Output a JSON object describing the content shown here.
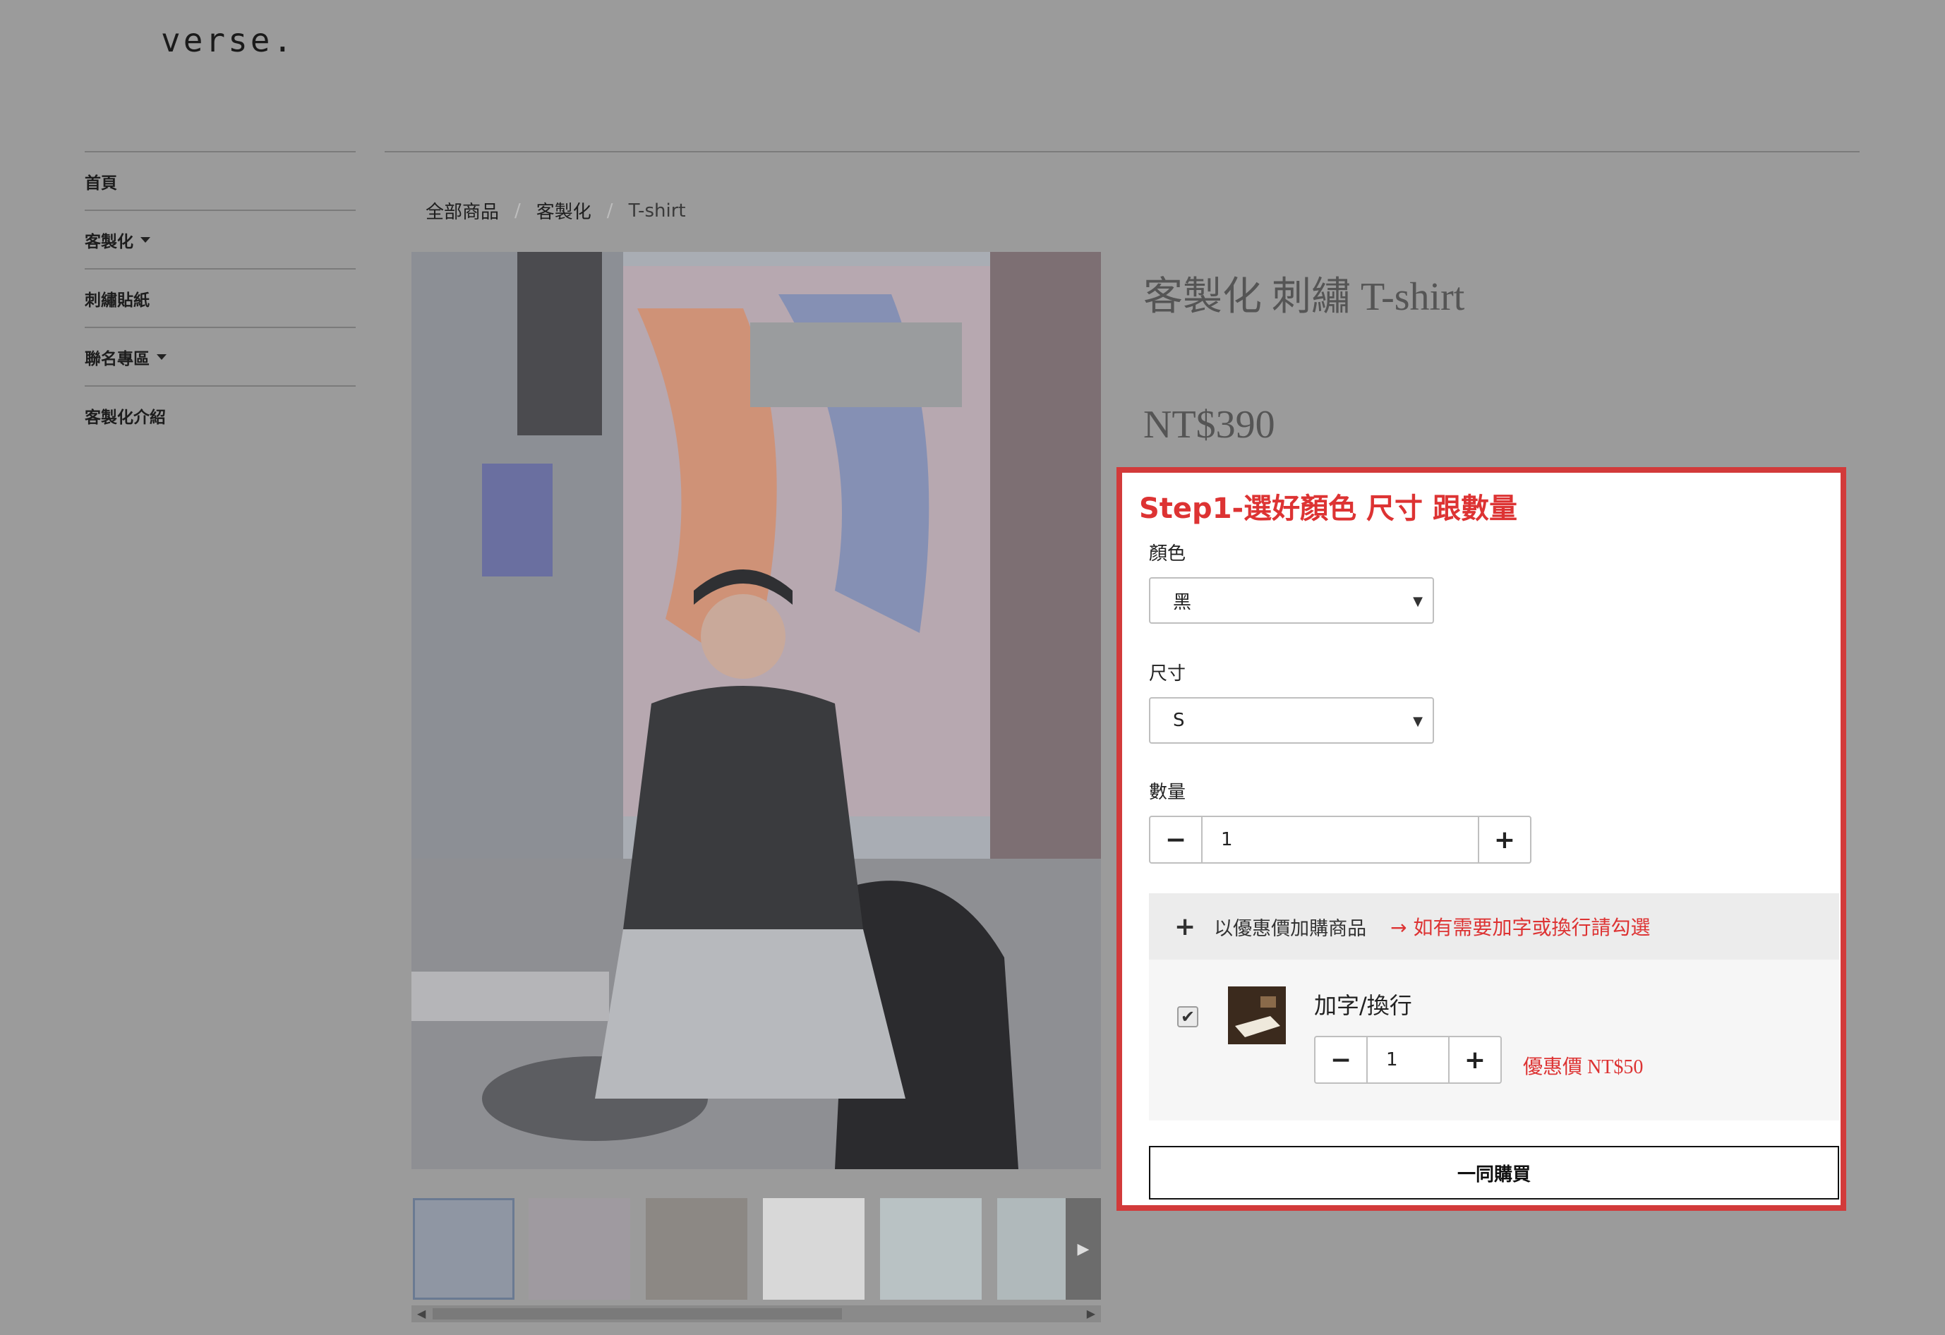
{
  "site": {
    "logo": "verse."
  },
  "sidebar": {
    "items": [
      {
        "label": "首頁",
        "has_dropdown": false
      },
      {
        "label": "客製化",
        "has_dropdown": true
      },
      {
        "label": "刺繡貼紙",
        "has_dropdown": false
      },
      {
        "label": "聯名專區",
        "has_dropdown": true
      },
      {
        "label": "客製化介紹",
        "has_dropdown": false
      }
    ]
  },
  "breadcrumb": [
    "全部商品",
    "客製化",
    "T-shirt"
  ],
  "product": {
    "title": "客製化 刺繡 T-shirt",
    "price": "NT$390"
  },
  "panel": {
    "step_title": "Step1-選好顏色 尺寸 跟數量",
    "color": {
      "label": "顏色",
      "value": "黑"
    },
    "size": {
      "label": "尺寸",
      "value": "S"
    },
    "quantity": {
      "label": "數量",
      "value": "1"
    },
    "addon": {
      "header": "以優惠價加購商品",
      "note": "→ 如有需要加字或換行請勾選",
      "item_name": "加字/換行",
      "item_qty": "1",
      "checked": true,
      "promo_price": "優惠價 NT$50"
    },
    "buy_button": "一同購買"
  },
  "colors": {
    "highlight_border": "#d23a3a",
    "accent_red": "#dd3333",
    "page_overlay": "#9b9b9b"
  },
  "icons": [
    "caret-down-icon",
    "minus-icon",
    "plus-icon",
    "checkbox-icon",
    "chevron-right-icon"
  ]
}
